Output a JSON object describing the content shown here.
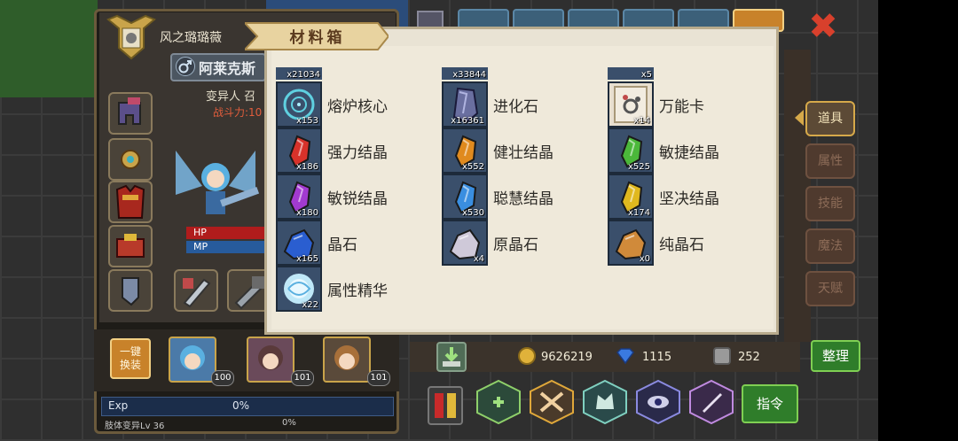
{
  "character": {
    "player_name": "风之璐璐薇",
    "class_name": "阿莱克斯",
    "race": "变异人 召",
    "power": "战斗力:10",
    "hp_label": "HP",
    "mp_label": "MP"
  },
  "party": {
    "auto_equip_label_line1": "一键",
    "auto_equip_label_line2": "换装",
    "heroes": [
      {
        "level": "100"
      },
      {
        "level": "101"
      },
      {
        "level": "101"
      }
    ]
  },
  "exp": {
    "label": "Exp",
    "percent": "0%",
    "sub_label": "肢体变异Lv 36",
    "sub_percent": "0%"
  },
  "popup": {
    "title": "材料箱",
    "partial_top": [
      "x21034",
      "x33844",
      "x5"
    ],
    "items": [
      {
        "name": "熔炉核心",
        "qty": "x153",
        "icon": "furnace-core-icon",
        "color": "#2b5f7a"
      },
      {
        "name": "进化石",
        "qty": "x16361",
        "icon": "evolution-stone-icon",
        "color": "#4b4f7a"
      },
      {
        "name": "万能卡",
        "qty": "x14",
        "icon": "universal-card-icon",
        "color": "#e8dfcf"
      },
      {
        "name": "强力结晶",
        "qty": "x186",
        "icon": "strength-crystal-icon",
        "color": "#d8322a"
      },
      {
        "name": "健壮结晶",
        "qty": "x552",
        "icon": "vitality-crystal-icon",
        "color": "#e08a1e"
      },
      {
        "name": "敏捷结晶",
        "qty": "x525",
        "icon": "agility-crystal-icon",
        "color": "#4bb83a"
      },
      {
        "name": "敏锐结晶",
        "qty": "x180",
        "icon": "acuity-crystal-icon",
        "color": "#a23ad0"
      },
      {
        "name": "聪慧结晶",
        "qty": "x530",
        "icon": "wisdom-crystal-icon",
        "color": "#3a8ee0"
      },
      {
        "name": "坚决结晶",
        "qty": "x174",
        "icon": "resolve-crystal-icon",
        "color": "#e0b81e"
      },
      {
        "name": "晶石",
        "qty": "x165",
        "icon": "crystal-stone-icon",
        "color": "#2a5ed0"
      },
      {
        "name": "原晶石",
        "qty": "x4",
        "icon": "raw-crystal-icon",
        "color": "#cfc9d9"
      },
      {
        "name": "纯晶石",
        "qty": "x0",
        "icon": "pure-crystal-icon",
        "color": "#d08a3a"
      },
      {
        "name": "属性精华",
        "qty": "x22",
        "icon": "attribute-essence-icon",
        "color": "#7fd0f0"
      }
    ]
  },
  "right_tabs": [
    {
      "label": "道具",
      "active": true
    },
    {
      "label": "属性",
      "active": false
    },
    {
      "label": "技能",
      "active": false
    },
    {
      "label": "魔法",
      "active": false
    },
    {
      "label": "天赋",
      "active": false
    }
  ],
  "currency": {
    "gold": "9626219",
    "diamond": "1115",
    "token": "252"
  },
  "buttons": {
    "sort": "整理",
    "command": "指令",
    "close": "✖"
  }
}
